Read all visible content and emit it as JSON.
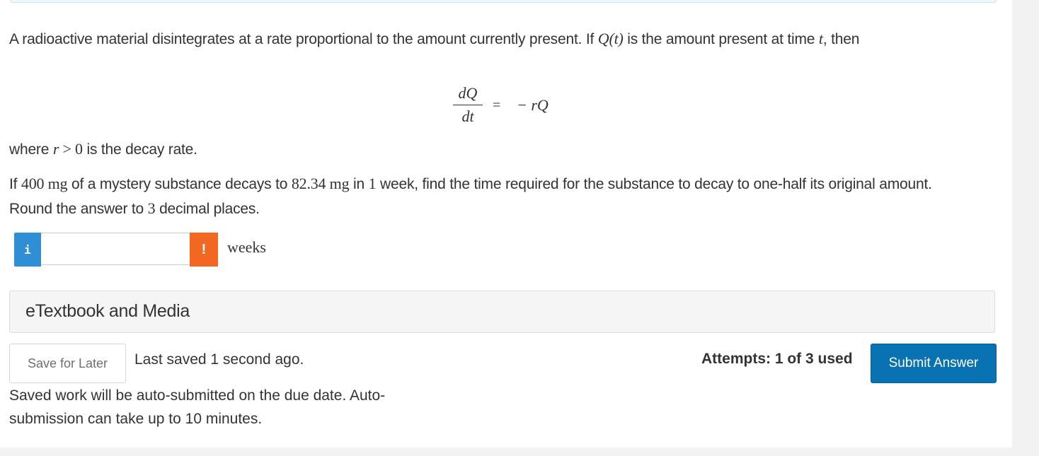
{
  "question": {
    "p1": {
      "t1": "A radioactive material disintegrates at a rate proportional to the amount currently present. If ",
      "m1": "Q(t)",
      "t2": " is the amount present at time ",
      "m2": "t",
      "t3": ", then"
    },
    "equation": {
      "numerator": "dQ",
      "denominator": "dt",
      "relation": "=",
      "rhs": "− rQ"
    },
    "p2": {
      "t1": "where ",
      "m1": "r",
      "rel": " > ",
      "m2": "0",
      "t2": " is the decay rate."
    },
    "p3": {
      "t1": "If ",
      "m1": "400 mg",
      "t2": " of a mystery substance decays to ",
      "m2": "82.34 mg",
      "t3": " in ",
      "m3": "1",
      "t4": " week, find the time required for the substance to decay to one-half its original amount. Round the answer to ",
      "m4": "3",
      "t5": " decimal places."
    }
  },
  "answer": {
    "info_icon_glyph": "i",
    "value": "",
    "placeholder": "",
    "warning_icon_glyph": "!",
    "unit": "weeks"
  },
  "etextbook_label": "eTextbook and Media",
  "footer": {
    "save_label": "Save for Later",
    "last_saved": "Last saved 1 second ago.",
    "auto_note": "Saved work will be auto-submitted on the due date. Auto-submission can take up to 10 minutes.",
    "attempts": "Attempts: 1 of 3 used",
    "submit_label": "Submit Answer"
  },
  "colors": {
    "info": "#2f8fd5",
    "warning": "#f26722",
    "submit": "#0872b3"
  }
}
